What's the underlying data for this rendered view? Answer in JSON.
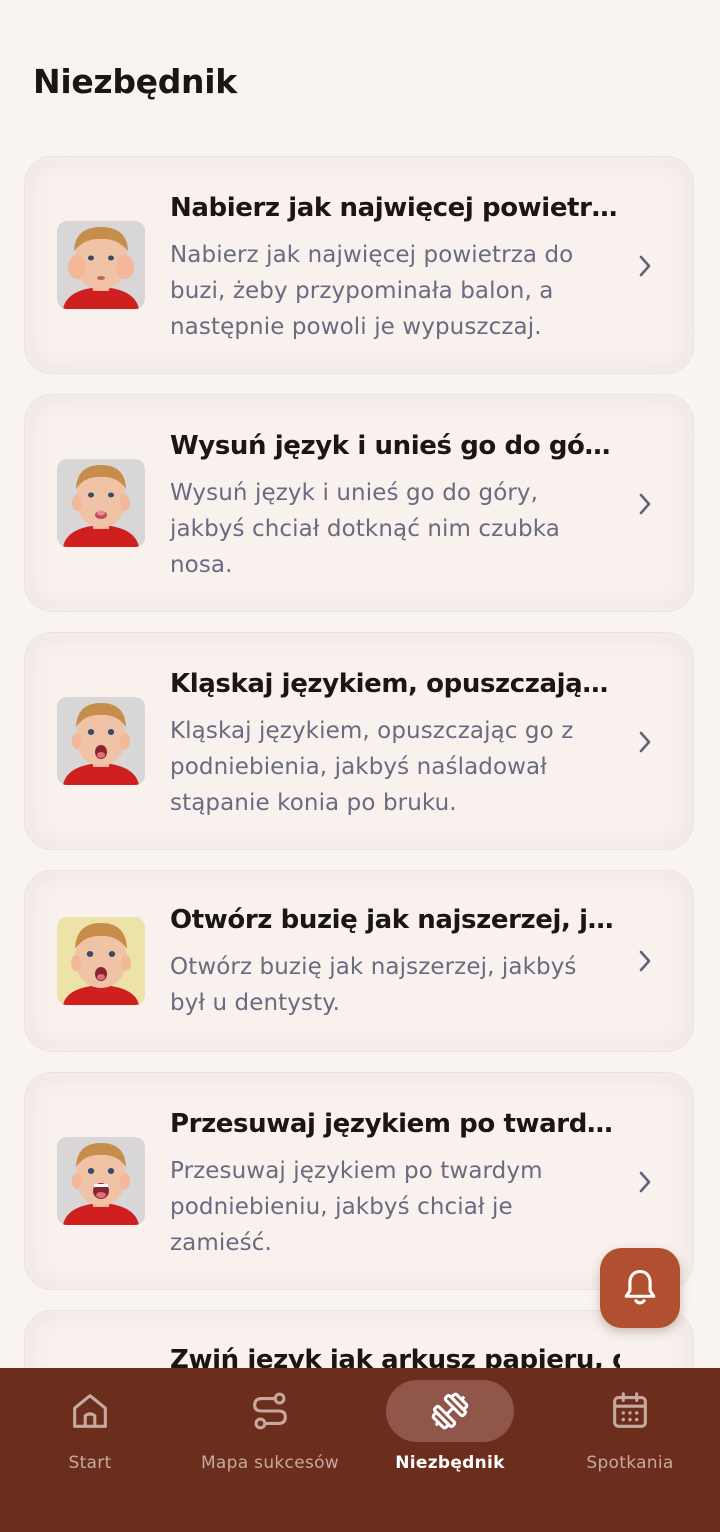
{
  "page": {
    "title": "Niezbędnik"
  },
  "exercises": [
    {
      "title": "Nabierz jak najwięcej powietrza do buzi, żeby przypominała balon, a następnie powoli je wypuszczaj.",
      "description": "Nabierz jak najwięcej powietrza do buzi, żeby przypominała balon, a następnie powoli je wypuszczaj.",
      "image": "boy-puffed-cheeks"
    },
    {
      "title": "Wysuń język i unieś go do góry, jakbyś chciał dotknąć nim czubka nosa.",
      "description": "Wysuń język i unieś go do góry, jakbyś chciał dotknąć nim czubka nosa.",
      "image": "boy-tongue-up"
    },
    {
      "title": "Kląskaj językiem, opuszczając go z podniebienia, jakbyś naśladował stąpanie konia po bruku.",
      "description": "Kląskaj językiem, opuszczając go z podniebienia, jakbyś naśladował stąpanie konia po bruku.",
      "image": "boy-mouth-open"
    },
    {
      "title": "Otwórz buzię jak najszerzej, jakbyś był u dentysty.",
      "description": "Otwórz buzię jak najszerzej, jakbyś był u dentysty.",
      "image": "boy-wide-open"
    },
    {
      "title": "Przesuwaj językiem po twardym podniebieniu, jakbyś chciał je zamieść.",
      "description": "Przesuwaj językiem po twardym podniebieniu, jakbyś chciał je zamieść.",
      "image": "boy-tongue-palate"
    },
    {
      "title": "Zwiń język jak arkusz papieru, d"
    }
  ],
  "fab": {
    "icon": "bell-icon"
  },
  "nav": [
    {
      "label": "Start",
      "icon": "home-icon",
      "active": false
    },
    {
      "label": "Mapa sukcesów",
      "icon": "route-icon",
      "active": false
    },
    {
      "label": "Niezbędnik",
      "icon": "dumbbell-icon",
      "active": true
    },
    {
      "label": "Spotkania",
      "icon": "calendar-icon",
      "active": false
    }
  ],
  "colors": {
    "background": "#f9f3f1",
    "navbar": "#6b2e1c",
    "nav_active_pill": "#91564a",
    "fab": "#b05030",
    "description_text": "#6a6a80"
  }
}
